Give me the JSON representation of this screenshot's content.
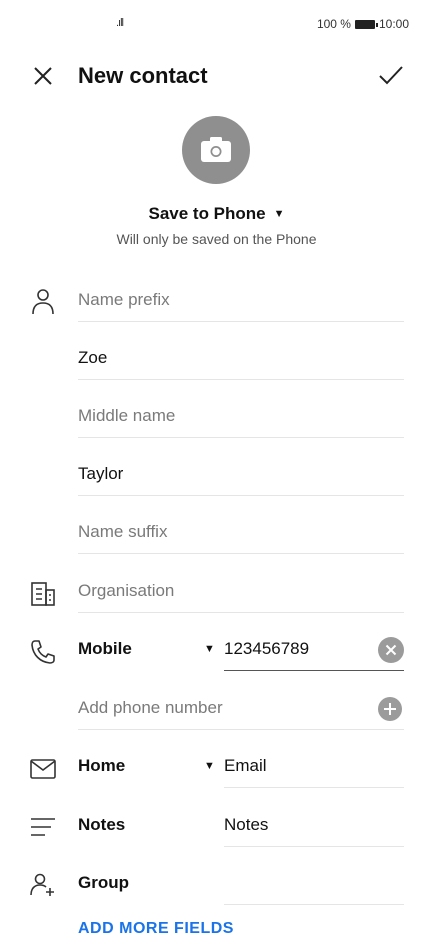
{
  "status_bar": {
    "signal": ".ıll",
    "battery": "100 %",
    "time": "10:00"
  },
  "header": {
    "title": "New contact",
    "close_icon": "close-icon",
    "confirm_icon": "check-icon"
  },
  "photo": {
    "icon": "camera-icon"
  },
  "save_location": {
    "label": "Save to Phone",
    "subtitle": "Will only be saved on the Phone"
  },
  "name_fields": {
    "prefix_placeholder": "Name prefix",
    "first_name": "Zoe",
    "middle_placeholder": "Middle name",
    "last_name": "Taylor",
    "suffix_placeholder": "Name suffix"
  },
  "organisation": {
    "placeholder": "Organisation"
  },
  "phone": {
    "type": "Mobile",
    "number": "123456789",
    "add_label": "Add phone number"
  },
  "email": {
    "type": "Home",
    "placeholder": "Email"
  },
  "notes": {
    "label": "Notes",
    "placeholder": "Notes"
  },
  "group": {
    "label": "Group"
  },
  "more_fields": {
    "label": "ADD MORE FIELDS"
  }
}
